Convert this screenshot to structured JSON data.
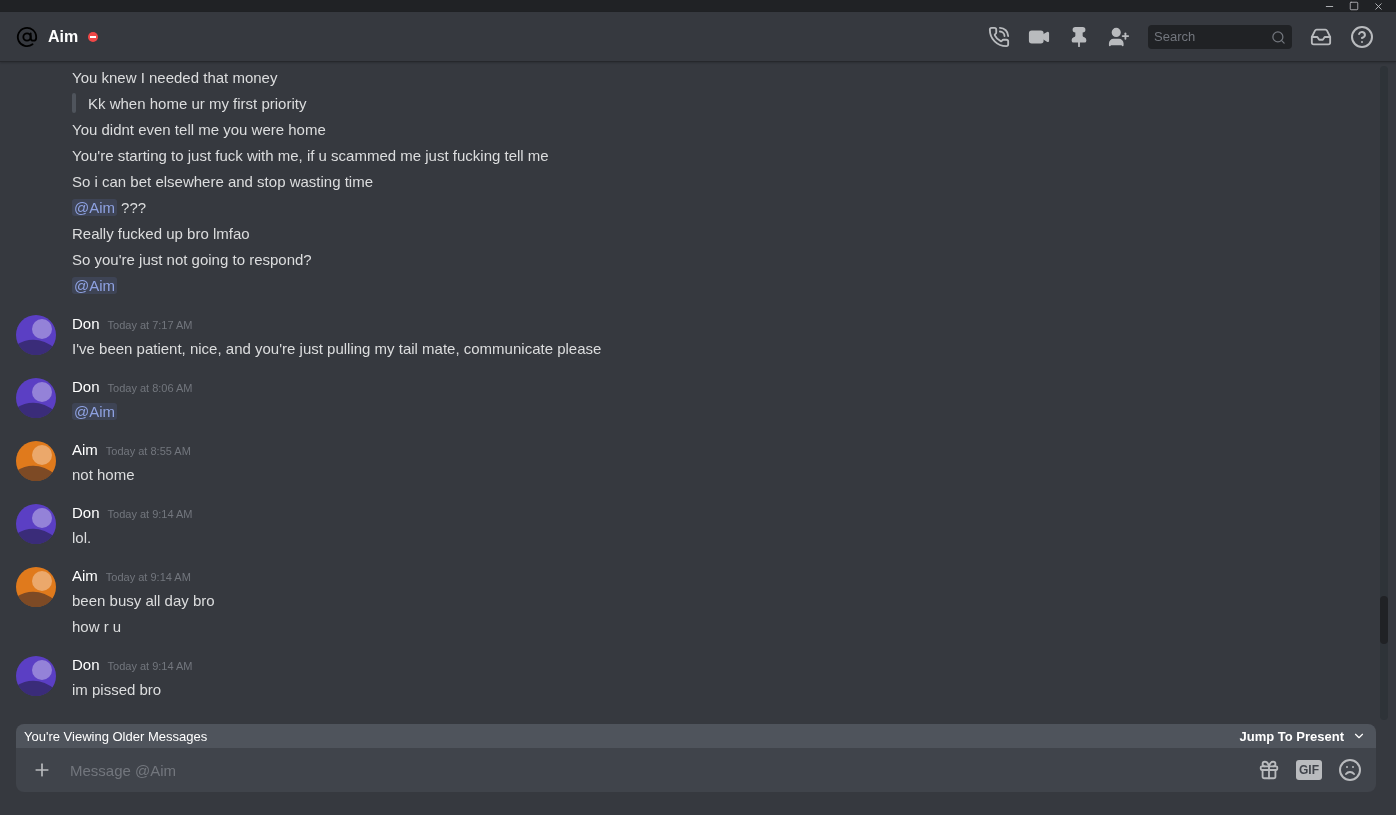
{
  "header": {
    "title": "Aim",
    "search": {
      "placeholder": "Search"
    }
  },
  "groups": [
    {
      "lines": [
        {
          "kind": "text",
          "text": "You knew I needed that money"
        },
        {
          "kind": "quote",
          "text": "Kk when home ur my first priority"
        },
        {
          "kind": "text",
          "text": "You didnt even tell me you were home"
        },
        {
          "kind": "text",
          "text": "You're starting to just fuck with me, if u scammed me just fucking tell me"
        },
        {
          "kind": "text",
          "text": "So i can bet elsewhere and stop wasting time"
        },
        {
          "kind": "mention",
          "mention": "@Aim",
          "text": "???"
        },
        {
          "kind": "text",
          "text": "Really fucked up bro lmfao"
        },
        {
          "kind": "text",
          "text": "So you're just not going to respond?"
        },
        {
          "kind": "mention",
          "mention": "@Aim"
        }
      ]
    },
    {
      "author": "Don",
      "color": "#5b3fc4",
      "time": "Today at 7:17 AM",
      "lines": [
        {
          "kind": "text",
          "text": "I've been patient, nice, and you're just pulling my tail mate, communicate please"
        }
      ]
    },
    {
      "author": "Don",
      "color": "#5b3fc4",
      "time": "Today at 8:06 AM",
      "lines": [
        {
          "kind": "mention",
          "mention": "@Aim"
        }
      ]
    },
    {
      "author": "Aim",
      "color": "#e07a1c",
      "time": "Today at 8:55 AM",
      "lines": [
        {
          "kind": "text",
          "text": "not home"
        }
      ]
    },
    {
      "author": "Don",
      "color": "#5b3fc4",
      "time": "Today at 9:14 AM",
      "lines": [
        {
          "kind": "text",
          "text": "lol."
        }
      ]
    },
    {
      "author": "Aim",
      "color": "#e07a1c",
      "time": "Today at 9:14 AM",
      "lines": [
        {
          "kind": "text",
          "text": "been busy all day bro"
        },
        {
          "kind": "text",
          "text": "how r u"
        }
      ]
    },
    {
      "author": "Don",
      "color": "#5b3fc4",
      "time": "Today at 9:14 AM",
      "lines": [
        {
          "kind": "text",
          "text": "im pissed bro"
        }
      ]
    }
  ],
  "older_bar": {
    "text": "You're Viewing Older Messages",
    "action": "Jump To Present"
  },
  "composer": {
    "placeholder": "Message @Aim",
    "gif": "GIF"
  }
}
